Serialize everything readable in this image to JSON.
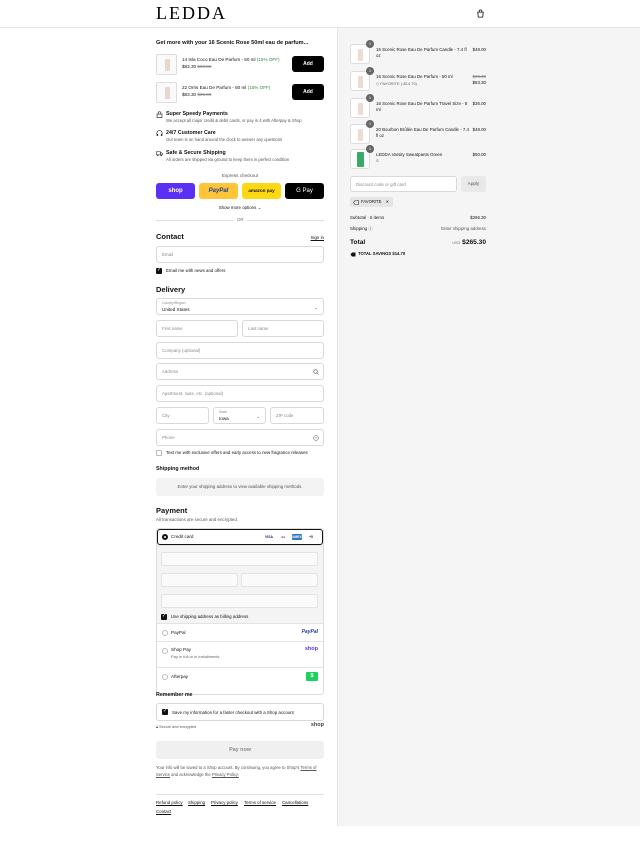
{
  "header": {
    "logo": "LEDDA",
    "bag_icon": "shopping-bag-icon"
  },
  "upsell": {
    "title": "Get more with your 16 Scenic Rose 50ml eau de parfum...",
    "items": [
      {
        "name": "14 Isla Coco Eau De Parfum - 50 ml",
        "discount": "(15% OFF)",
        "price": "$83.30",
        "compare_price": "$98.00",
        "button": "Add"
      },
      {
        "name": "22 Orris Eau De Parfum - 50 ml",
        "discount": "(15% OFF)",
        "price": "$83.30",
        "compare_price": "$98.00",
        "button": "Add"
      }
    ]
  },
  "perks": [
    {
      "icon": "lock-icon",
      "title": "Super Speedy Payments",
      "desc": "We accept all major credit & debit cards, or pay in 4 with Afterpay & Shop"
    },
    {
      "icon": "headset-icon",
      "title": "24/7 Customer Care",
      "desc": "Our team is on hand around the clock to answer any questions"
    },
    {
      "icon": "truck-icon",
      "title": "Safe & Secure Shipping",
      "desc": "All orders are shipped via ground to keep them in perfect condition"
    }
  ],
  "express": {
    "label": "Express checkout",
    "buttons": [
      "shop",
      "PayPal",
      "amazon pay",
      "G Pay"
    ],
    "show_more": "Show more options",
    "or": "OR"
  },
  "contact": {
    "heading": "Contact",
    "sign_in": "Sign in",
    "email_placeholder": "Email",
    "email_news_label": "Email me with news and offers"
  },
  "delivery": {
    "heading": "Delivery",
    "country_label": "Country/Region",
    "country_value": "United States",
    "first_name": "First name",
    "last_name": "Last name",
    "company": "Company (optional)",
    "address": "Address",
    "apartment": "Apartment, suite, etc. (optional)",
    "city": "City",
    "state_label": "State",
    "state_value": "Iowa",
    "zip": "ZIP code",
    "phone": "Phone",
    "sms_label": "Text me with exclusive offers and early access to new fragrance releases"
  },
  "shipping": {
    "heading": "Shipping method",
    "message": "Enter your shipping address to view available shipping methods."
  },
  "payment": {
    "heading": "Payment",
    "subtext": "All transactions are secure and encrypted.",
    "credit_card_label": "Credit card",
    "card_logos": [
      "VISA",
      "MC",
      "AMEX",
      "+5"
    ],
    "billing_label": "Use shipping address as billing address",
    "methods": [
      {
        "label": "PayPal",
        "logo": "PayPal",
        "sub": ""
      },
      {
        "label": "Shop Pay",
        "logo": "shop",
        "sub": "Pay in full or in installments"
      },
      {
        "label": "Afterpay",
        "logo": "$",
        "sub": ""
      }
    ]
  },
  "remember": {
    "heading": "Remember me",
    "save_label": "Save my information for a faster checkout with a Shop account",
    "secure_label": "Secure and encrypted",
    "shop_logo": "shop"
  },
  "pay_now": "Pay now",
  "legal": {
    "prefix": "Your info will be saved to a Shop account. By continuing, you agree to Shop's",
    "terms": "Terms of Service",
    "middle": "and acknowledge the",
    "privacy": "Privacy Policy."
  },
  "footer_links": [
    "Refund policy",
    "Shipping",
    "Privacy policy",
    "Terms of service",
    "Cancellations",
    "Contact"
  ],
  "order": {
    "items": [
      {
        "qty": "1",
        "name": "16 Scenic Rose Eau De Parfum Candle - 7.4 fl oz",
        "sub": "",
        "price": "$48.00",
        "compare": ""
      },
      {
        "qty": "1",
        "name": "16 Scenic Rose Eau De Parfum - 50 ml",
        "sub": "FAVORITE (-$14.70)",
        "price": "$83.30",
        "compare": "$98.00"
      },
      {
        "qty": "1",
        "name": "16 Scenic Rose Eau De Parfum Travel Size - 8 ml",
        "sub": "",
        "price": "$36.00",
        "compare": ""
      },
      {
        "qty": "1",
        "name": "20 Bourbon Brûlée Eau De Parfum Candle - 7.4 fl oz",
        "sub": "",
        "price": "$48.00",
        "compare": ""
      },
      {
        "qty": "1",
        "name": "LEDDA Varsity Sweatpants Green",
        "sub": "S",
        "price": "$50.00",
        "compare": ""
      }
    ],
    "discount_placeholder": "Discount code or gift card",
    "apply": "Apply",
    "tag": "FAVORITE",
    "subtotal_label": "Subtotal · 5 items",
    "subtotal_value": "$265.30",
    "shipping_label": "Shipping",
    "shipping_value": "Enter shipping address",
    "total_label": "Total",
    "currency": "USD",
    "total_value": "$265.30",
    "savings_label": "TOTAL SAVINGS",
    "savings_value": "$14.70"
  },
  "colors": {
    "shop_purple": "#5a31f4",
    "paypal_yellow": "#ffc439",
    "amazon_yellow": "#ffd814",
    "gpay_black": "#000000",
    "discount_green": "#2a8a3a",
    "afterpay_green": "#1dd15f"
  }
}
